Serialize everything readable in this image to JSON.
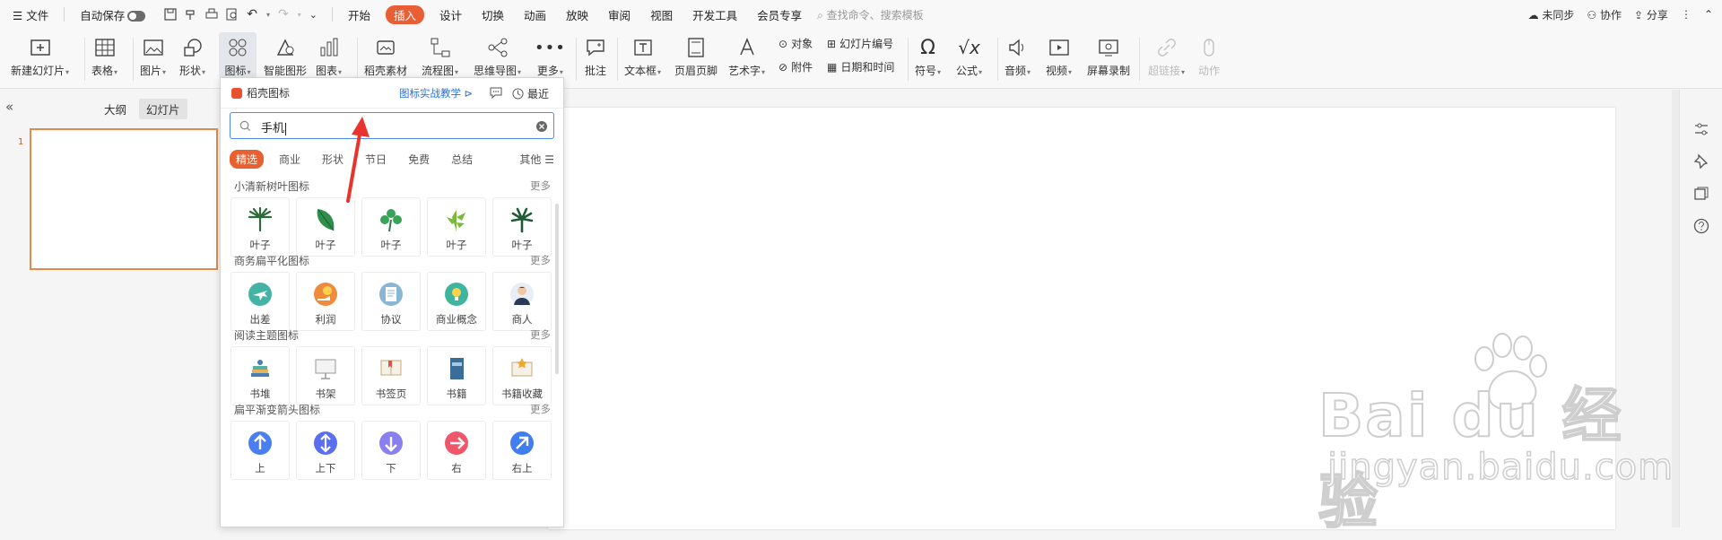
{
  "menubar": {
    "file": "文件",
    "autosave": "自动保存",
    "tabs": [
      "开始",
      "插入",
      "设计",
      "切换",
      "动画",
      "放映",
      "审阅",
      "视图",
      "开发工具",
      "会员专享"
    ],
    "active_tab": "插入",
    "search_placeholder": "查找命令、搜索模板",
    "unsynced": "未同步",
    "collaborate": "协作",
    "share": "分享"
  },
  "ribbon": {
    "new_slide": "新建幻灯片",
    "table": "表格",
    "picture": "图片",
    "shape": "形状",
    "icon": "图标",
    "smart_graphic": "智能图形",
    "chart": "图表",
    "daoke_material": "稻壳素材",
    "flowchart": "流程图",
    "mindmap": "思维导图",
    "more": "更多",
    "comment": "批注",
    "textbox": "文本框",
    "header_footer": "页眉页脚",
    "wordart": "艺术字",
    "object": "对象",
    "attachment": "附件",
    "slide_number": "幻灯片编号",
    "date_time": "日期和时间",
    "symbol": "符号",
    "formula": "公式",
    "audio": "音频",
    "video": "视频",
    "screen_record": "屏幕录制",
    "hyperlink": "超链接",
    "action": "动作"
  },
  "left_pane": {
    "collapse": "«",
    "outline": "大纲",
    "slides": "幻灯片",
    "slide_number": "1"
  },
  "icon_panel": {
    "title": "稻壳图标",
    "tutorial": "图标实战教学",
    "recent": "最近",
    "search_value": "手机",
    "filters": [
      "精选",
      "商业",
      "形状",
      "节日",
      "免费",
      "总结"
    ],
    "active_filter": "精选",
    "other": "其他",
    "sections": [
      {
        "title": "小清新树叶图标",
        "more": "更多",
        "items": [
          "叶子",
          "叶子",
          "叶子",
          "叶子",
          "叶子"
        ]
      },
      {
        "title": "商务扁平化图标",
        "more": "更多",
        "items": [
          "出差",
          "利润",
          "协议",
          "商业概念",
          "商人"
        ]
      },
      {
        "title": "阅读主题图标",
        "more": "更多",
        "items": [
          "书堆",
          "书架",
          "书签页",
          "书籍",
          "书籍收藏"
        ]
      },
      {
        "title": "扁平渐变箭头图标",
        "more": "更多",
        "items": [
          "上",
          "上下",
          "下",
          "右",
          "右上"
        ]
      }
    ]
  },
  "watermark": {
    "brand": "Bai du 经验",
    "url": "jingyan.baidu.com"
  },
  "colors": {
    "accent": "#ea5e36",
    "link": "#2b6fd6",
    "thumb_border": "#e38a4a"
  }
}
